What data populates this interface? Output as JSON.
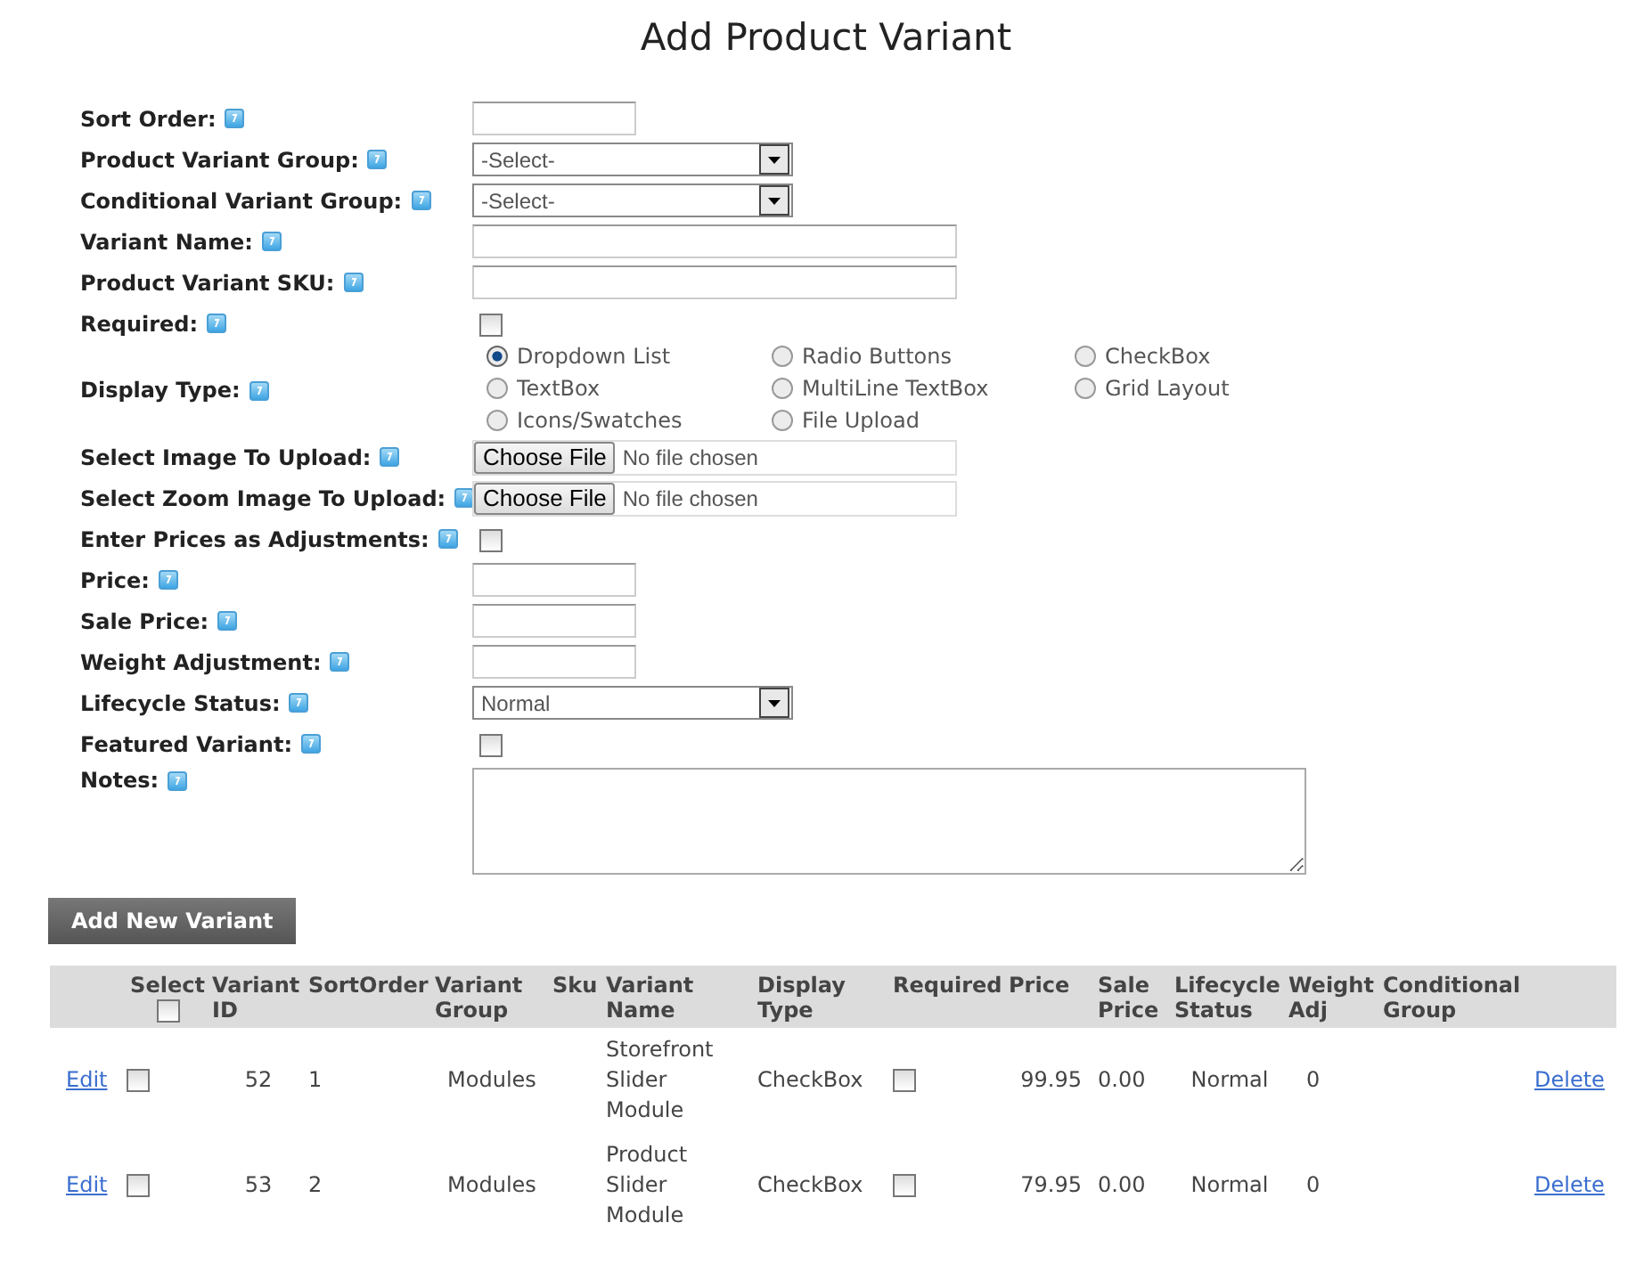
{
  "title": "Add Product Variant",
  "fields": [
    {
      "kind": "short",
      "label": "Sort Order:"
    },
    {
      "kind": "select",
      "label": "Product Variant Group:",
      "value": "-Select-"
    },
    {
      "kind": "select",
      "label": "Conditional Variant Group:",
      "value": "-Select-"
    },
    {
      "kind": "text",
      "label": "Variant Name:"
    },
    {
      "kind": "text",
      "label": "Product Variant SKU:"
    },
    {
      "kind": "checkbox",
      "label": "Required:",
      "checked": false
    },
    {
      "kind": "radios",
      "label": "Display Type:",
      "options": [
        {
          "label": "Dropdown List",
          "selected": true
        },
        {
          "label": "Radio Buttons",
          "selected": false
        },
        {
          "label": "CheckBox",
          "selected": false
        },
        {
          "label": "TextBox",
          "selected": false
        },
        {
          "label": "MultiLine TextBox",
          "selected": false
        },
        {
          "label": "Grid Layout",
          "selected": false
        },
        {
          "label": "Icons/Swatches",
          "selected": false
        },
        {
          "label": "File Upload",
          "selected": false
        }
      ]
    },
    {
      "kind": "file",
      "label": "Select Image To Upload:",
      "button": "Choose File",
      "status": "No file chosen"
    },
    {
      "kind": "file",
      "label": "Select Zoom Image To Upload:",
      "button": "Choose File",
      "status": "No file chosen"
    },
    {
      "kind": "checkbox",
      "label": "Enter Prices as Adjustments:",
      "checked": false
    },
    {
      "kind": "short",
      "label": "Price:"
    },
    {
      "kind": "short",
      "label": "Sale Price:"
    },
    {
      "kind": "short",
      "label": "Weight Adjustment:"
    },
    {
      "kind": "select",
      "label": "Lifecycle Status:",
      "value": "Normal"
    },
    {
      "kind": "checkbox",
      "label": "Featured Variant:",
      "checked": false
    },
    {
      "kind": "textarea",
      "label": "Notes:"
    }
  ],
  "add_button": "Add New Variant",
  "table": {
    "columns": [
      {
        "label": "Select",
        "kind": "select",
        "checked": false
      },
      {
        "label": "Variant ID"
      },
      {
        "label": "SortOrder"
      },
      {
        "label": "Variant Group"
      },
      {
        "label": "Sku"
      },
      {
        "label": "Variant Name"
      },
      {
        "label": "Display Type"
      },
      {
        "label": "Required"
      },
      {
        "label": "Price"
      },
      {
        "label": "Sale Price"
      },
      {
        "label": "Lifecycle Status"
      },
      {
        "label": "Weight Adj"
      },
      {
        "label": "Conditional Group"
      }
    ],
    "rows": [
      {
        "edit": "Edit",
        "selected": false,
        "id": "52",
        "sort": "1",
        "group": "Modules",
        "name": "Storefront Slider Module",
        "display": "CheckBox",
        "required": false,
        "price": "99.95",
        "sale": "0.00",
        "status": "Normal",
        "weight": "0",
        "delete": "Delete"
      },
      {
        "edit": "Edit",
        "selected": false,
        "id": "53",
        "sort": "2",
        "group": "Modules",
        "name": "Product Slider Module",
        "display": "CheckBox",
        "required": false,
        "price": "79.95",
        "sale": "0.00",
        "status": "Normal",
        "weight": "0",
        "delete": "Delete"
      }
    ]
  }
}
